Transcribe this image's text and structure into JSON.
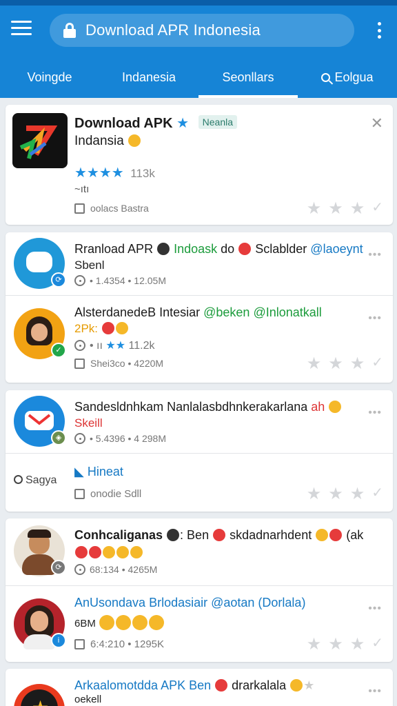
{
  "appbar": {
    "search_text": "Download APR Indonesia"
  },
  "tabs": [
    {
      "label": "Voingde"
    },
    {
      "label": "Indanesia"
    },
    {
      "label": "Seonllars"
    },
    {
      "label": "Eolgua"
    }
  ],
  "featured": {
    "title": "Download APK",
    "tag": "Neanla",
    "subtitle": "Indansia",
    "stars": "★★★★",
    "count": "113k",
    "extra": "~ıtı",
    "meta": "oolacs Bastra",
    "close": "✕"
  },
  "items": [
    {
      "title_a": "Rranload APR",
      "title_b": "Indoask",
      "title_c": "do",
      "title_d": "Sclablder",
      "title_e": "@laoeynt",
      "sub": "Sbenl",
      "meta": "• 1.4354 • 12.05M",
      "accent": "#2098d8"
    },
    {
      "title_a": "AlsterdanedeB Intesiar",
      "title_b": "@beken @Inlonatkall",
      "sub": "2Pk:",
      "stars_meta": "• ıı",
      "stars": "★★",
      "count": "11.2k",
      "meta": "Shei3co • 4220M",
      "accent": "#f2a213"
    },
    {
      "title": "Sandesldnhkam Nanlalasbdhnkerakarlana",
      "title_tail": "ah",
      "sub": "Skeill",
      "meta": "• 5.4396 • 4 298M",
      "accent": "#1b89dc"
    },
    {
      "search_label": "Sagya",
      "title": "Hineat",
      "meta": "onodie  Sdll"
    },
    {
      "title_a": "Conhcaliganas",
      "title_b": ": Ben",
      "title_c": "skdadnarhdent",
      "title_d": "(ak",
      "meta": "68:134 • 4265M",
      "accent": "#7b4a2c"
    },
    {
      "title": "AnUsondava Brlodasiair @aotan (Dorlala)",
      "sub": "6BM",
      "meta": "6:4:210 • 1295K",
      "accent": "#b5232b"
    },
    {
      "title_a": "Arkaalomotdda APK Ben",
      "title_b": "drarkalala",
      "sub": "oekell",
      "accent": "#e93a1e"
    }
  ],
  "icons": {
    "star_empty_color": "#d4d6d9",
    "star_blue_color": "#1e8fe0",
    "brand_blue": "#1684d6"
  }
}
